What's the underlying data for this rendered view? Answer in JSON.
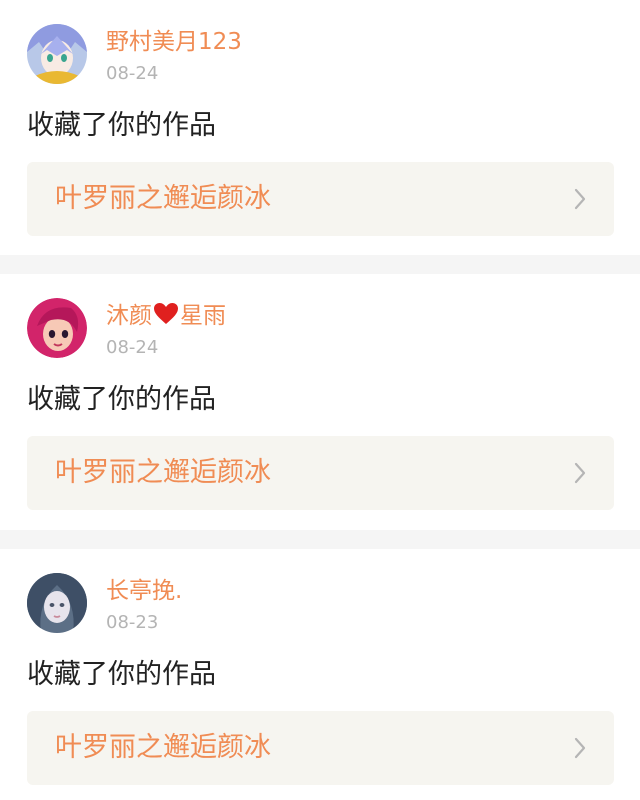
{
  "notifications": [
    {
      "username": "野村美月123",
      "date": "08-24",
      "action": "收藏了你的作品",
      "work_title": "叶罗丽之邂逅颜冰"
    },
    {
      "username_part1": "沐颜",
      "username_part2": "星雨",
      "date": "08-24",
      "action": "收藏了你的作品",
      "work_title": "叶罗丽之邂逅颜冰"
    },
    {
      "username": "长亭挽.",
      "date": "08-23",
      "action": "收藏了你的作品",
      "work_title": "叶罗丽之邂逅颜冰"
    }
  ],
  "icons": {
    "chevron": "chevron-right-icon",
    "heart": "red-heart-emoji"
  },
  "colors": {
    "username": "#f08c54",
    "work_title": "#f08c54",
    "date": "#b4b4b4",
    "card_background": "#f6f5f0",
    "separator": "#f5f5f5",
    "heart": "#e0201f"
  }
}
